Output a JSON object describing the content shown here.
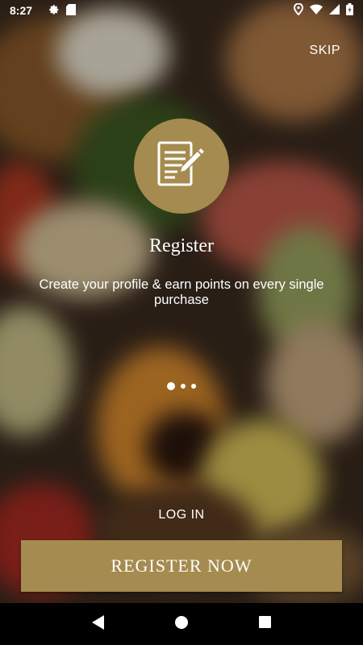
{
  "status_bar": {
    "time": "8:27",
    "left_icons": [
      "gear-icon",
      "sd-card-icon"
    ],
    "right_icons": [
      "location-icon",
      "wifi-icon",
      "signal-icon",
      "battery-icon"
    ]
  },
  "onboarding": {
    "skip_label": "SKIP",
    "icon": "register-form-pencil-icon",
    "title": "Register",
    "subtitle": "Create your profile & earn points on every single purchase",
    "pager": {
      "total": 3,
      "active": 1
    },
    "login_label": "LOG IN",
    "register_button_label": "REGISTER NOW"
  },
  "nav_bar": {
    "buttons": [
      "back-icon",
      "home-icon",
      "recents-icon"
    ]
  },
  "colors": {
    "accent": "#a58b4f",
    "text": "#ffffff",
    "navbar": "#000000"
  }
}
